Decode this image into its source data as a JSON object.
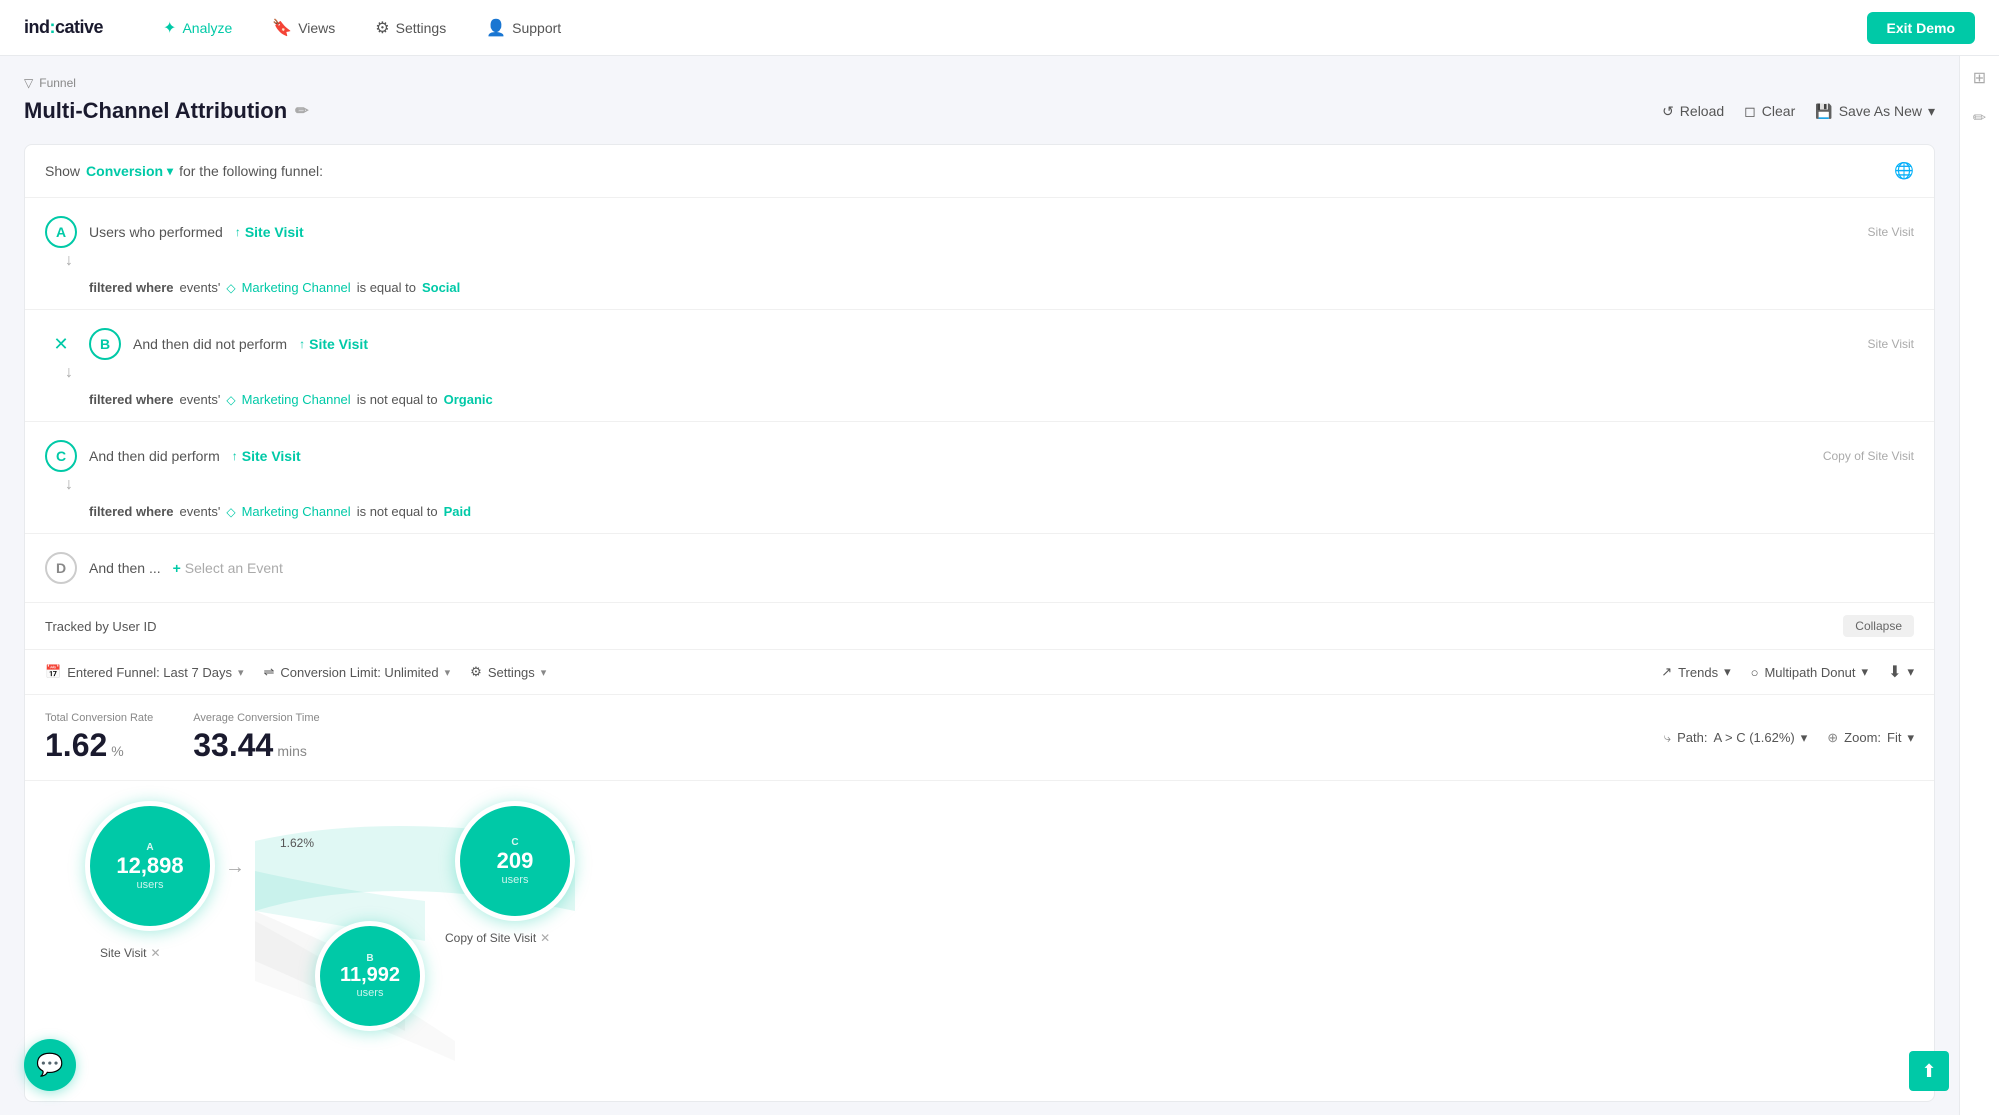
{
  "nav": {
    "logo": "ind:cative",
    "logo_highlight": ":",
    "links": [
      {
        "label": "Analyze",
        "icon": "⚙",
        "active": true
      },
      {
        "label": "Views",
        "icon": "🔖",
        "active": false
      },
      {
        "label": "Settings",
        "icon": "⚙",
        "active": false
      },
      {
        "label": "Support",
        "icon": "👤",
        "active": false
      }
    ],
    "exit_label": "Exit Demo"
  },
  "breadcrumb": {
    "icon": "▽",
    "label": "Funnel"
  },
  "page": {
    "title": "Multi-Channel Attribution",
    "edit_icon": "✏"
  },
  "header_actions": {
    "reload_label": "Reload",
    "clear_label": "Clear",
    "save_label": "Save As New"
  },
  "show_row": {
    "prefix": "Show",
    "conversion": "Conversion",
    "suffix": "for the following funnel:"
  },
  "steps": [
    {
      "letter": "A",
      "prefix": "Users who performed",
      "event": "Site Visit",
      "filter_keyword": "filtered where",
      "filter_events": "events'",
      "filter_prop": "Marketing Channel",
      "filter_op": "is equal to",
      "filter_val": "Social",
      "right_label": "Site Visit",
      "active": true
    },
    {
      "letter": "B",
      "prefix": "And then did not perform",
      "event": "Site Visit",
      "filter_keyword": "filtered where",
      "filter_events": "events'",
      "filter_prop": "Marketing Channel",
      "filter_op": "is not equal to",
      "filter_val": "Organic",
      "right_label": "Site Visit",
      "active": true,
      "has_cross_icon": true
    },
    {
      "letter": "C",
      "prefix": "And then did perform",
      "event": "Site Visit",
      "filter_keyword": "filtered where",
      "filter_events": "events'",
      "filter_prop": "Marketing Channel",
      "filter_op": "is not equal to",
      "filter_val": "Paid",
      "right_label": "Copy of Site Visit",
      "active": true
    }
  ],
  "step_d": {
    "letter": "D",
    "prefix": "And then ...",
    "select_label": "Select an Event"
  },
  "tracked_by": "Tracked by User ID",
  "collapse_label": "Collapse",
  "funnel_settings": {
    "entered": "Entered Funnel: Last 7 Days",
    "conversion_limit": "Conversion Limit: Unlimited",
    "settings": "Settings",
    "trends_label": "Trends",
    "multipath_label": "Multipath Donut"
  },
  "metrics": {
    "total_conversion_label": "Total\nConversion\nRate",
    "total_conversion_value": "1.62",
    "total_conversion_unit": "%",
    "avg_conversion_label": "Average\nConversion\nTime",
    "avg_conversion_value": "33.44",
    "avg_conversion_unit": "mins",
    "path_label": "Path:",
    "path_value": "A > C (1.62%)",
    "zoom_label": "Zoom:",
    "zoom_value": "Fit"
  },
  "chart": {
    "nodes": [
      {
        "letter": "A",
        "value": "12,898",
        "sublabel": "users",
        "label": "Site Visit"
      },
      {
        "letter": "B",
        "value": "11,992",
        "sublabel": "users",
        "label": ""
      },
      {
        "letter": "C",
        "value": "209",
        "sublabel": "users",
        "label": "Copy of Site Visit"
      }
    ],
    "conversion_pct": "1.62%"
  }
}
